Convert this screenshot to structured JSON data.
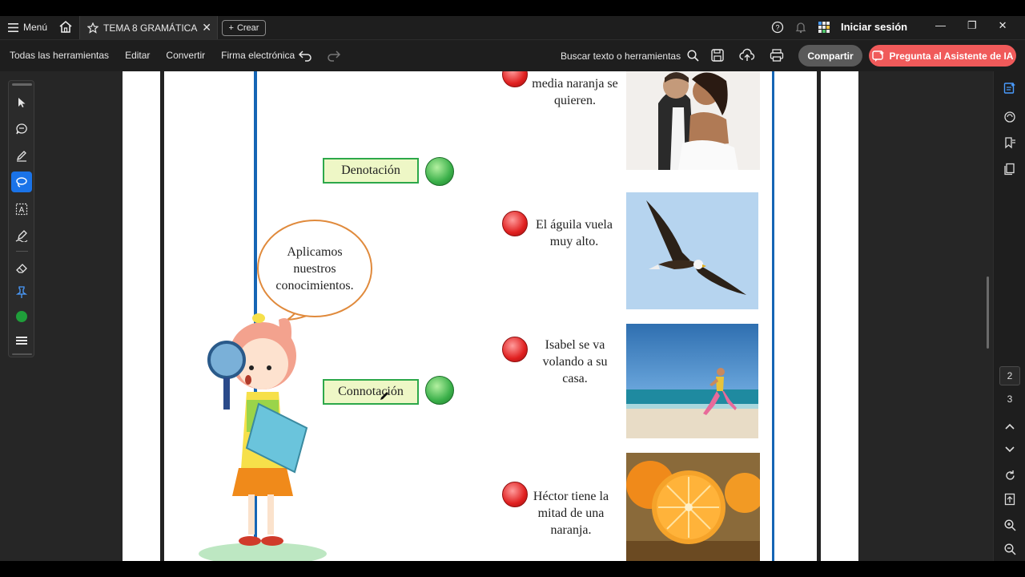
{
  "tabbar": {
    "menu_label": "Menú",
    "tab_title": "TEMA 8 GRAMÁTICA ...",
    "create_label": "Crear",
    "signin_label": "Iniciar sesión"
  },
  "toolbar": {
    "items": [
      "Todas las herramientas",
      "Editar",
      "Convertir",
      "Firma electrónica"
    ],
    "search_label": "Buscar texto o herramientas",
    "share_label": "Compartir",
    "ai_label": "Pregunta al Asistente de IA"
  },
  "document": {
    "bubble_text": "Aplicamos nuestros conocimientos.",
    "denotation_label": "Denotación",
    "connotation_label": "Connotación",
    "sentences": [
      "media naranja se quieren.",
      "El águila vuela muy alto.",
      "Isabel se va volando a su casa.",
      "Héctor tiene la mitad de una naranja."
    ]
  },
  "rightrail": {
    "pages": [
      "2",
      "3"
    ]
  },
  "colors": {
    "accent_blue": "#1a73e8",
    "ai_button": "#f05a5a",
    "frame_line_blue": "#1565b5",
    "box_green": "#2da84a"
  }
}
